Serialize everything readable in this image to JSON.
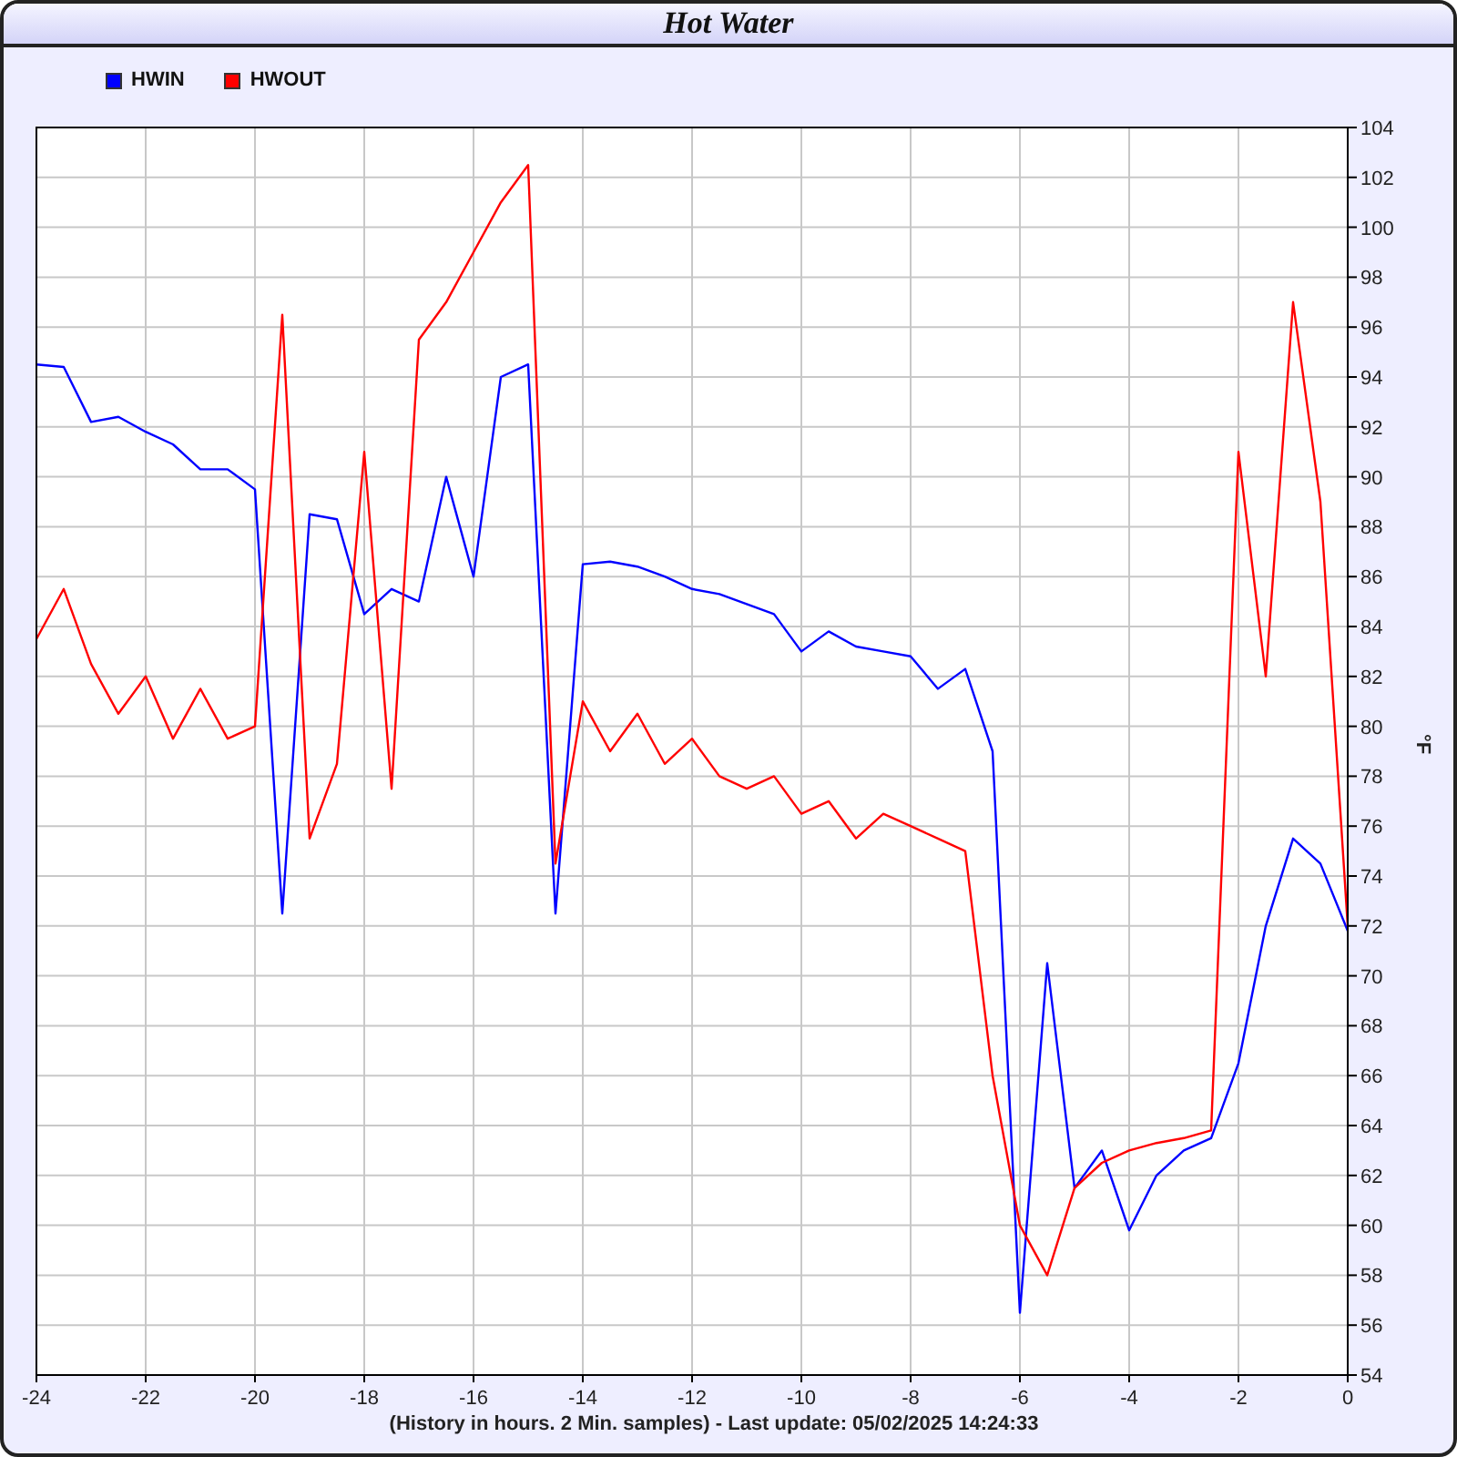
{
  "chart_data": {
    "type": "line",
    "title": "Hot Water",
    "xlabel": "(History in hours. 2 Min. samples) - Last update: 05/02/2025 14:24:33",
    "ylabel": "°F",
    "x": [
      -24,
      -23.5,
      -23,
      -22.5,
      -22,
      -21.5,
      -21,
      -20.5,
      -20,
      -19.5,
      -19,
      -18.5,
      -18,
      -17.5,
      -17,
      -16.5,
      -16,
      -15.5,
      -15,
      -14.5,
      -14,
      -13.5,
      -13,
      -12.5,
      -12,
      -11.5,
      -11,
      -10.5,
      -10,
      -9.5,
      -9,
      -8.5,
      -8,
      -7.5,
      -7,
      -6.5,
      -6,
      -5.5,
      -5,
      -4.5,
      -4,
      -3.5,
      -3,
      -2.5,
      -2,
      -1.5,
      -1,
      -0.5,
      0
    ],
    "series": [
      {
        "name": "HWIN",
        "color": "#0000ff",
        "values": [
          94.5,
          94.4,
          92.2,
          92.4,
          91.8,
          91.3,
          90.3,
          90.3,
          89.5,
          72.5,
          88.5,
          88.3,
          84.5,
          85.5,
          85,
          90,
          86,
          94,
          94.5,
          72.5,
          86.5,
          86.6,
          86.4,
          86,
          85.5,
          85.3,
          84.9,
          84.5,
          83,
          83.8,
          83.2,
          83,
          82.8,
          81.5,
          82.3,
          79,
          56.5,
          70.5,
          61.5,
          63,
          59.8,
          62,
          63,
          63.5,
          66.5,
          72,
          75.5,
          74.5,
          71.8
        ]
      },
      {
        "name": "HWOUT",
        "color": "#ff0000",
        "values": [
          83.5,
          85.5,
          82.5,
          80.5,
          82,
          79.5,
          81.5,
          79.5,
          80,
          96.5,
          75.5,
          78.5,
          91,
          77.5,
          95.5,
          97,
          99,
          101,
          102.5,
          74.5,
          81,
          79,
          80.5,
          78.5,
          79.5,
          78,
          77.5,
          78,
          76.5,
          77,
          75.5,
          76.5,
          76,
          75.5,
          75,
          66,
          60,
          58,
          61.5,
          62.5,
          63,
          63.3,
          63.5,
          63.8,
          91,
          82,
          97,
          89,
          72
        ]
      }
    ],
    "grid": true,
    "xlim": [
      -24,
      0
    ],
    "ylim": [
      54,
      104
    ],
    "xticks": [
      -24,
      -22,
      -20,
      -18,
      -16,
      -14,
      -12,
      -10,
      -8,
      -6,
      -4,
      -2,
      0
    ],
    "yticks": [
      54,
      56,
      58,
      60,
      62,
      64,
      66,
      68,
      70,
      72,
      74,
      76,
      78,
      80,
      82,
      84,
      86,
      88,
      90,
      92,
      94,
      96,
      98,
      100,
      102,
      104
    ]
  }
}
